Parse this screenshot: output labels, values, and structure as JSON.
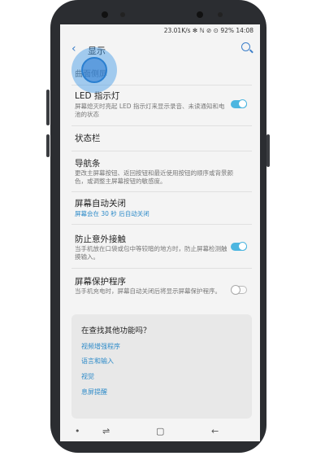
{
  "statusbar": {
    "left": "",
    "right": "23.01K/s ✻ ℕ ⊘ ⊙ 92% 14:08"
  },
  "appbar": {
    "back": "‹",
    "title": "显示"
  },
  "partial_item": "曲面侧屏",
  "items": [
    {
      "title": "LED 指示灯",
      "subtitle": "屏幕熄灭时亮起 LED 指示灯来显示录音、未读通知和电池的状态",
      "toggle": "on"
    },
    {
      "title": "状态栏",
      "subtitle": ""
    },
    {
      "title": "导航条",
      "subtitle": "更改主屏幕按钮、返回按钮和最近使用按钮的顺序或背景颜色，或调整主屏幕按钮的敏感度。"
    },
    {
      "title": "屏幕自动关闭",
      "subtitle": "屏幕会在 30 秒 后自动关闭",
      "subtitle_color": "blue"
    },
    {
      "title": "防止意外接触",
      "subtitle": "当手机放在口袋或包中等较暗的地方时，防止屏幕检测触摸输入。",
      "toggle": "on"
    },
    {
      "title": "屏幕保护程序",
      "subtitle": "当手机充电时，屏幕自动关闭后将显示屏幕保护程序。",
      "toggle": "off"
    }
  ],
  "card": {
    "heading": "在查找其他功能吗？",
    "links": [
      "视频增强程序",
      "语言和输入",
      "视觉",
      "息屏提醒"
    ]
  },
  "nav": {
    "dot": "•",
    "recent": "⇌",
    "home": "▢",
    "back": "←"
  }
}
